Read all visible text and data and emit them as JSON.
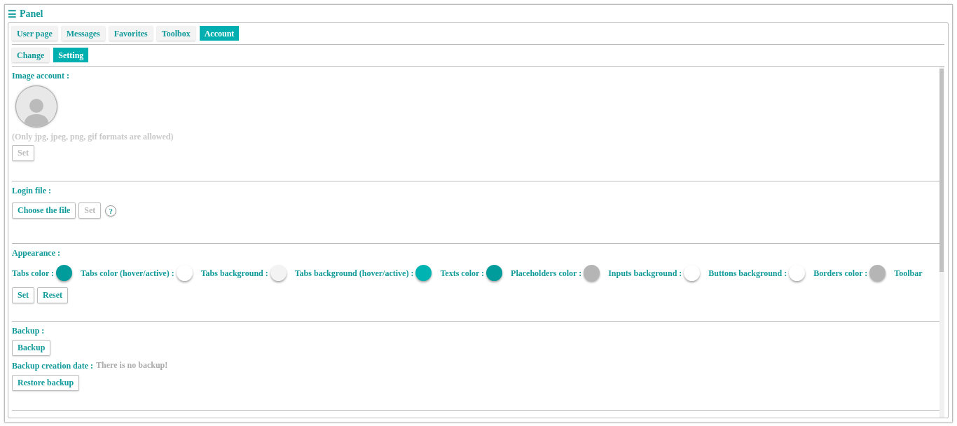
{
  "panel": {
    "icon": "☰",
    "title": "Panel"
  },
  "tabs": [
    {
      "label": "User page",
      "selected": false
    },
    {
      "label": "Messages",
      "selected": false
    },
    {
      "label": "Favorites",
      "selected": false
    },
    {
      "label": "Toolbox",
      "selected": false
    },
    {
      "label": "Account",
      "selected": true
    }
  ],
  "subtabs": [
    {
      "label": "Change",
      "selected": false
    },
    {
      "label": "Setting",
      "selected": true
    }
  ],
  "image_account": {
    "label": "Image account :",
    "note": "(Only jpg, jpeg, png, gif formats are allowed)",
    "set_button": {
      "label": "Set",
      "disabled": true
    }
  },
  "login_file": {
    "label": "Login file :",
    "buttons": [
      {
        "label": "Choose the file",
        "disabled": false
      },
      {
        "label": "Set",
        "disabled": true
      }
    ],
    "help": "?"
  },
  "appearance": {
    "label": "Appearance :",
    "swatches": [
      {
        "label": "Tabs color :",
        "color": "#009b9b"
      },
      {
        "label": "Tabs color (hover/active) :",
        "color": "#ffffff"
      },
      {
        "label": "Tabs background :",
        "color": "#f3f3f3"
      },
      {
        "label": "Tabs background (hover/active) :",
        "color": "#00b3b3"
      },
      {
        "label": "Texts color :",
        "color": "#009b9b"
      },
      {
        "label": "Placeholders color :",
        "color": "#b5b5b5"
      },
      {
        "label": "Inputs background :",
        "color": "#ffffff"
      },
      {
        "label": "Buttons background :",
        "color": "#ffffff"
      },
      {
        "label": "Borders color :",
        "color": "#b5b5b5"
      },
      {
        "label": "Toolbar"
      }
    ],
    "buttons": [
      {
        "label": "Set",
        "disabled": false
      },
      {
        "label": "Reset",
        "disabled": false
      }
    ]
  },
  "backup": {
    "label": "Backup :",
    "backup_button": {
      "label": "Backup",
      "disabled": false
    },
    "date_label": "Backup creation date :",
    "date_value": "There is no backup!",
    "restore_button": {
      "label": "Restore backup",
      "disabled": false
    }
  }
}
